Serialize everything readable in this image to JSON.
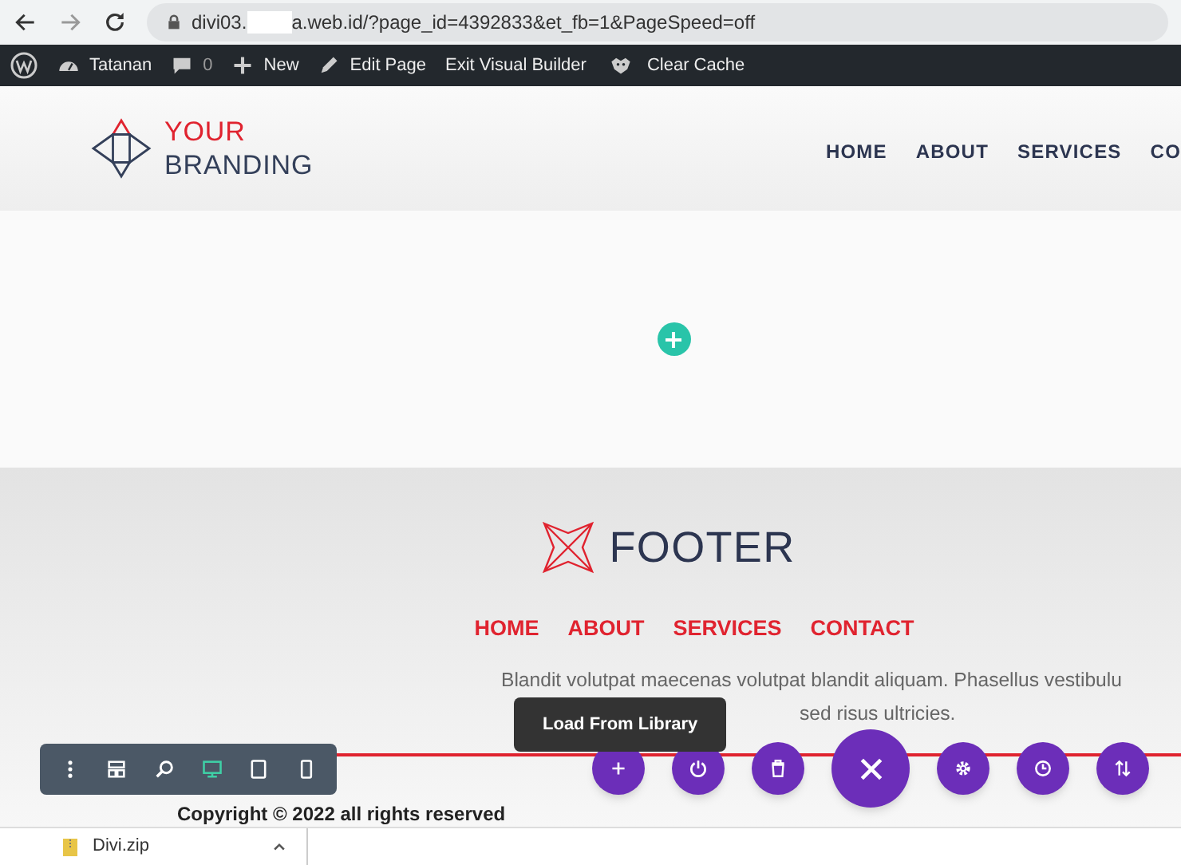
{
  "browser": {
    "url_start": "divi03.",
    "url_end": "a.web.id/?page_id=4392833&et_fb=1&PageSpeed=off"
  },
  "admin_bar": [
    {
      "kind": "wp"
    },
    {
      "kind": "dashboard",
      "label": "Tatanan"
    },
    {
      "kind": "comments",
      "label": "0"
    },
    {
      "kind": "new",
      "label": "New"
    },
    {
      "kind": "edit",
      "label": "Edit Page"
    },
    {
      "kind": "text",
      "label": "Exit Visual Builder"
    },
    {
      "kind": "cache",
      "label": "Clear Cache"
    }
  ],
  "header": {
    "logo_top": "YOUR",
    "logo_bottom": "BRANDING",
    "nav": [
      "HOME",
      "ABOUT",
      "SERVICES",
      "CO"
    ]
  },
  "footer": {
    "logo": "FOOTER",
    "nav": [
      "HOME",
      "ABOUT",
      "SERVICES",
      "CONTACT"
    ],
    "text_line_1": "Blandit volutpat maecenas volutpat blandit aliquam. Phasellus vestibulu",
    "text_line_2": "sed risus ultricies.",
    "copyright": "Copyright © 2022 all rights reserved"
  },
  "builder_toolbar": [
    {
      "kind": "menu",
      "selected": false
    },
    {
      "kind": "layout",
      "selected": false
    },
    {
      "kind": "zoom",
      "selected": false
    },
    {
      "kind": "desktop",
      "selected": true
    },
    {
      "kind": "tablet",
      "selected": false
    },
    {
      "kind": "phone",
      "selected": false
    }
  ],
  "page_actions": [
    {
      "kind": "add"
    },
    {
      "kind": "power"
    },
    {
      "kind": "trash"
    },
    {
      "kind": "close"
    },
    {
      "kind": "settings"
    },
    {
      "kind": "history"
    },
    {
      "kind": "sort"
    }
  ],
  "tooltip": "Load From Library",
  "download": {
    "file": "Divi.zip"
  }
}
